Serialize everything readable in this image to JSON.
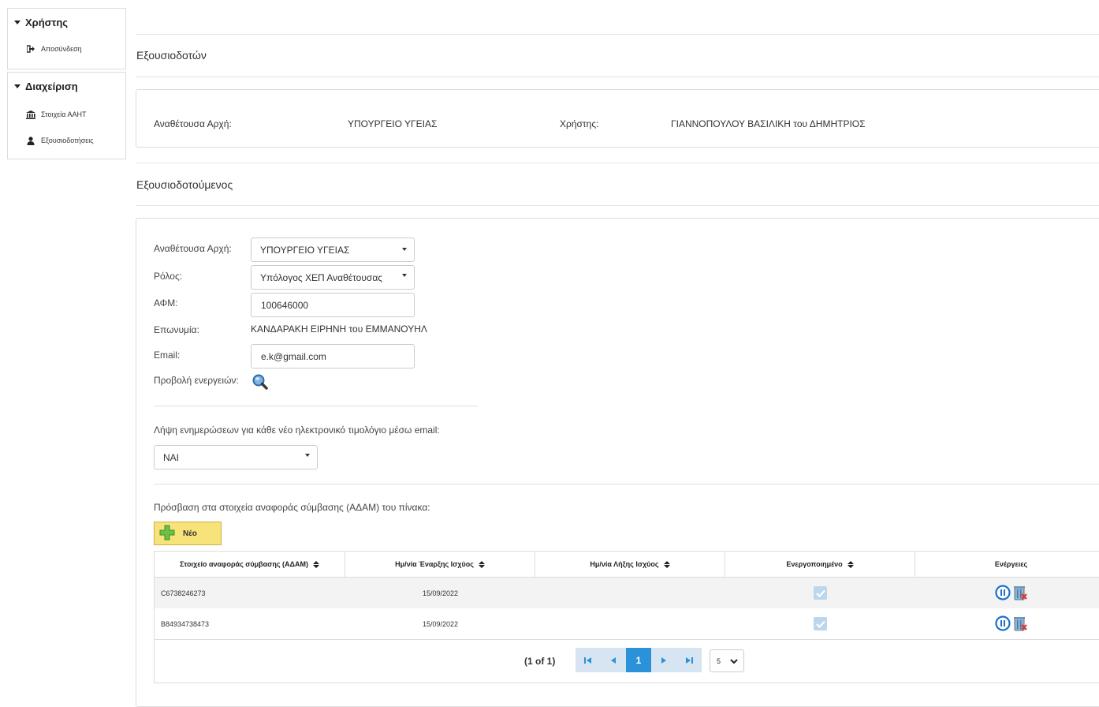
{
  "sidebar": {
    "user_panel": {
      "title": "Χρήστης",
      "items": [
        {
          "label": "Αποσύνδεση",
          "icon": "sign-out-icon"
        }
      ]
    },
    "admin_panel": {
      "title": "Διαχείριση",
      "items": [
        {
          "label": "Στοιχεία ΑΑΗΤ",
          "icon": "institution-icon"
        },
        {
          "label": "Εξουσιοδοτήσεις",
          "icon": "user-icon"
        }
      ]
    }
  },
  "authorizers": {
    "section_title": "Εξουσιοδοτών",
    "authority_label": "Αναθέτουσα Αρχή:",
    "authority_value": "ΥΠΟΥΡΓΕΙΟ ΥΓΕΙΑΣ",
    "user_label": "Χρήστης:",
    "user_value": "ΓΙΑΝΝΟΠΟΥΛΟΥ ΒΑΣΙΛΙΚΗ του ΔΗΜΗΤΡΙΟΣ"
  },
  "authorized": {
    "section_title": "Εξουσιοδοτούμενος",
    "authority_label": "Αναθέτουσα Αρχή:",
    "authority_value": "ΥΠΟΥΡΓΕΙΟ ΥΓΕΙΑΣ",
    "role_label": "Ρόλος:",
    "role_value": "Υπόλογος ΧΕΠ Αναθέτουσας",
    "afm_label": "ΑΦΜ:",
    "afm_value": "100646000",
    "surname_label": "Επωνυμία:",
    "surname_value": "ΚΑΝΔΑΡΑΚΗ ΕΙΡΗΝΗ του ΕΜΜΑΝΟΥΗΛ",
    "email_label": "Email:",
    "email_value": "e.k@gmail.com",
    "actions_label": "Προβολή ενεργειών:",
    "notify_label": "Λήψη ενημερώσεων για κάθε νέο ηλεκτρονικό τιμολόγιο μέσω email:",
    "notify_value": "ΝΑΙ",
    "access_label": "Πρόσβαση στα στοιχεία αναφοράς σύμβασης (ΑΔΑΜ) του πίνακα:",
    "new_button": "Νέο"
  },
  "table": {
    "headers": [
      "Στοιχείο αναφοράς σύμβασης (ΑΔΑΜ)",
      "Ημ/νία Έναρξης Ισχύος",
      "Ημ/νία Λήξης Ισχύος",
      "Ενεργοποιημένο",
      "Ενέργειες"
    ],
    "rows": [
      {
        "adam": "C6738246273",
        "start": "15/09/2022",
        "end": "",
        "enabled": true
      },
      {
        "adam": "B84934738473",
        "start": "15/09/2022",
        "end": "",
        "enabled": true
      }
    ],
    "pager": {
      "summary": "(1 of 1)",
      "current_page": "1",
      "rows_per_page": "5"
    }
  },
  "colors": {
    "accent": "#2b92da",
    "new_button_bg": "#f7e37a",
    "row_alt": "#f3f3f3"
  }
}
